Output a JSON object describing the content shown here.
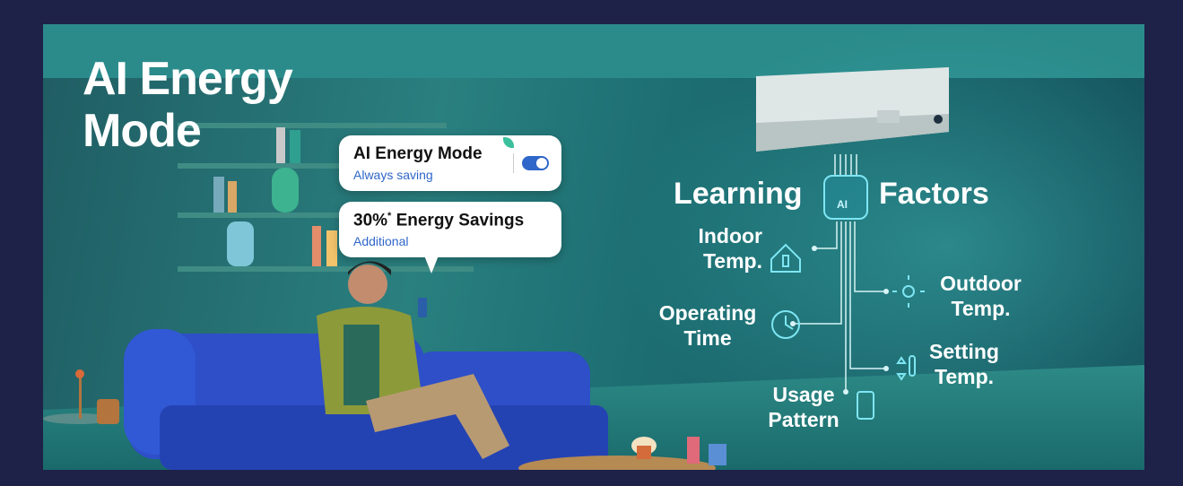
{
  "headline": {
    "line1": "AI Energy",
    "line2": "Mode"
  },
  "card_mode": {
    "title": "AI Energy Mode",
    "subtitle": "Always saving",
    "toggle_on": true
  },
  "card_savings": {
    "percent": "30%",
    "asterisk": "*",
    "title": " Energy Savings",
    "subtitle": "Additional"
  },
  "diagram": {
    "title_left": "Learning",
    "title_right": "Factors",
    "ai_badge": "AI",
    "factors": {
      "indoor_1": "Indoor",
      "indoor_2": "Temp.",
      "outdoor_1": "Outdoor",
      "outdoor_2": "Temp.",
      "operating_1": "Operating",
      "operating_2": "Time",
      "setting_1": "Setting",
      "setting_2": "Temp.",
      "usage_1": "Usage",
      "usage_2": "Pattern"
    }
  },
  "colors": {
    "frame": "#1e2148",
    "accent_line": "#d8f4f6",
    "icon": "#7ee6f3",
    "toggle": "#2f66c9"
  }
}
